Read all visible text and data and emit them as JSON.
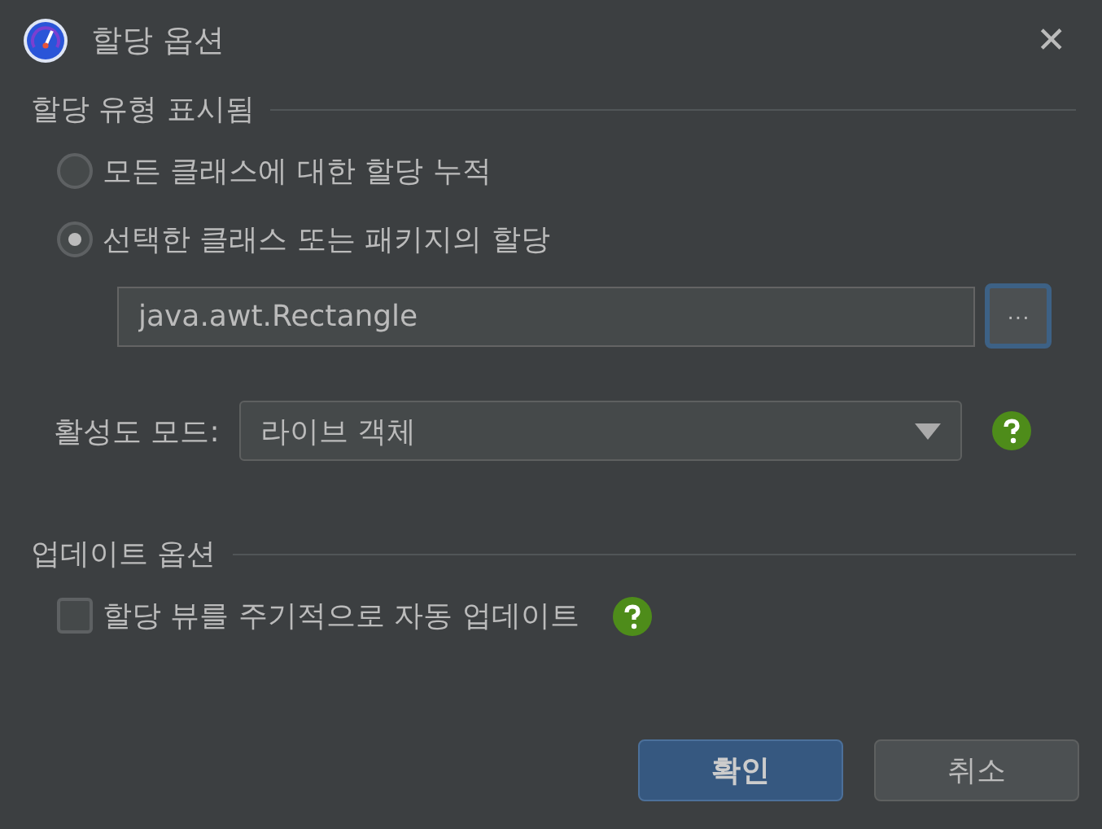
{
  "window": {
    "title": "할당 옵션",
    "close": "✕"
  },
  "sections": [
    {
      "title": "할당 유형 표시됨",
      "kind": "radios",
      "options": [
        {
          "label": "모든 클래스에 대한 할당 누적",
          "selected": false
        },
        {
          "label": "선택한 클래스 또는 패키지의 할당",
          "selected": true
        }
      ],
      "field": {
        "value": "java.awt.Rectangle",
        "button": "···"
      },
      "mode": {
        "label": "활성도 모드:",
        "value": "라이브 객체"
      }
    },
    {
      "title": "업데이트 옵션",
      "kind": "checks",
      "options": [
        {
          "label": "할당 뷰를 주기적으로 자동 업데이트",
          "checked": false
        }
      ]
    }
  ],
  "buttons": [
    {
      "label": "확인",
      "kind": "primary"
    },
    {
      "label": "취소",
      "kind": "normal"
    }
  ]
}
